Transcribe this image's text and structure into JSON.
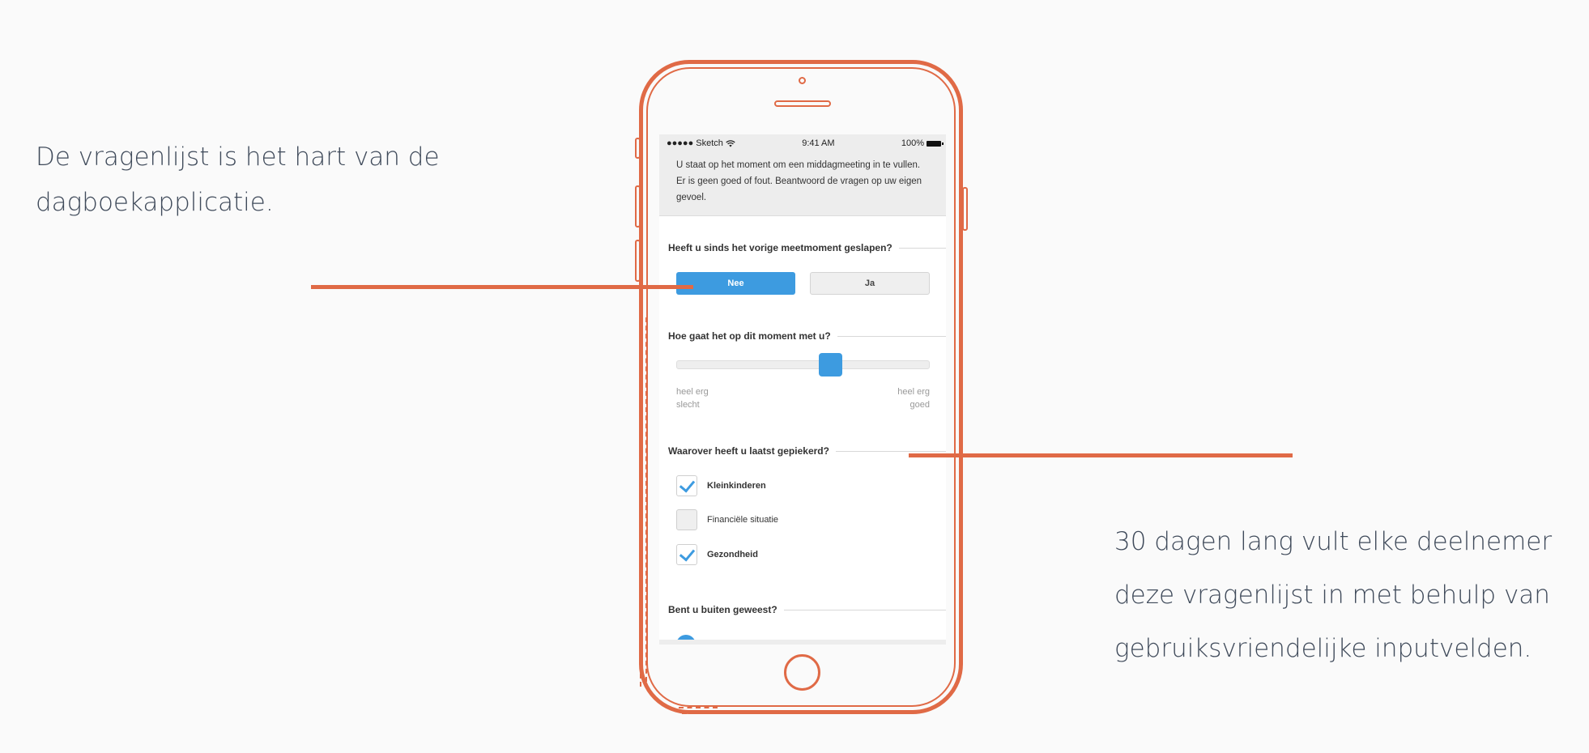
{
  "captions": {
    "left": "De vragenlijst is het hart van de dagboekapplicatie.",
    "right": "30 dagen lang vult elke deelnemer deze vragenlijst in met behulp van gebruiksvriendelijke inputvelden."
  },
  "status_bar": {
    "carrier": "●●●●● Sketch",
    "wifi_icon": "wifi-icon",
    "time": "9:41 AM",
    "battery": "100%"
  },
  "intro_text": "U staat op het moment om een middagmeeting in te vullen. Er is geen goed of fout. Beantwoord de vragen op uw eigen gevoel.",
  "questions": [
    {
      "label": "Heeft u sinds het vorige meetmoment geslapen?",
      "options": [
        {
          "label": "Nee",
          "selected": true
        },
        {
          "label": "Ja",
          "selected": false
        }
      ]
    },
    {
      "label": "Hoe gaat het op dit moment met u?",
      "slider": {
        "value_fraction": 0.62,
        "min_label_line1": "heel erg",
        "min_label_line2": "slecht",
        "max_label_line1": "heel erg",
        "max_label_line2": "goed"
      }
    },
    {
      "label": "Waarover heeft u laatst gepiekerd?",
      "checkboxes": [
        {
          "label": "Kleinkinderen",
          "checked": true
        },
        {
          "label": "Financiële situatie",
          "checked": false
        },
        {
          "label": "Gezondheid",
          "checked": true
        }
      ]
    },
    {
      "label": "Bent u buiten geweest?"
    }
  ],
  "colors": {
    "accent": "#e06a46",
    "primary_blue": "#3d9be0",
    "text": "#3f4a5a",
    "background": "#fafafa"
  }
}
